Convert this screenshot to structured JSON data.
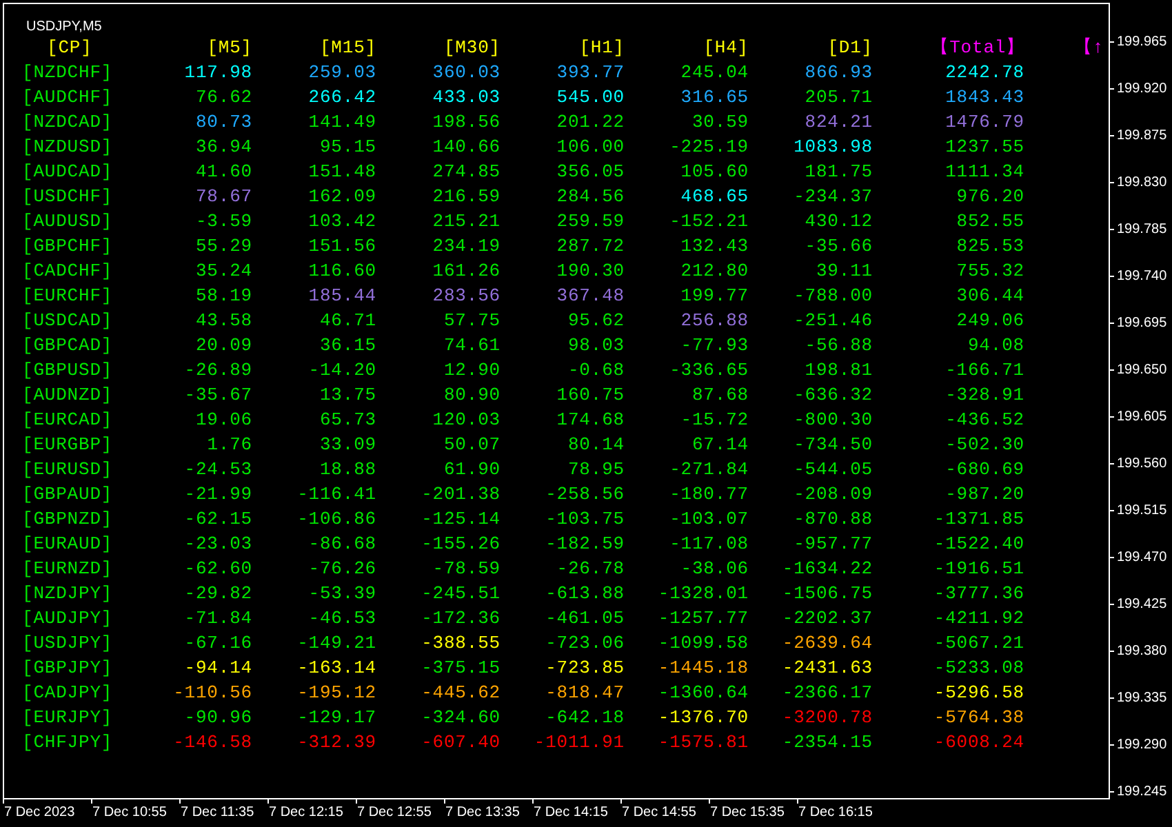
{
  "chart": {
    "title": "USDJPY,M5"
  },
  "table": {
    "pair_column": {
      "label": "[CP]",
      "color": "#ffff00"
    },
    "columns": [
      {
        "label": "[M5]",
        "color": "#ffff00"
      },
      {
        "label": "[M15]",
        "color": "#ffff00"
      },
      {
        "label": "[M30]",
        "color": "#ffff00"
      },
      {
        "label": "[H1]",
        "color": "#ffff00"
      },
      {
        "label": "[H4]",
        "color": "#ffff00"
      },
      {
        "label": "[D1]",
        "color": "#ffff00"
      },
      {
        "label": "【Total】",
        "color": "#ff00ff"
      },
      {
        "label": "【↑",
        "color": "#ff00ff"
      }
    ],
    "rows": [
      {
        "pair": "[NZDCHF]",
        "cells": [
          {
            "text": "117.98",
            "color": "#00ffff"
          },
          {
            "text": "259.03",
            "color": "#1eaaff"
          },
          {
            "text": "360.03",
            "color": "#1eaaff"
          },
          {
            "text": "393.77",
            "color": "#1eaaff"
          },
          {
            "text": "245.04",
            "color": "#00e600"
          },
          {
            "text": "866.93",
            "color": "#1eaaff"
          },
          {
            "text": "2242.78",
            "color": "#00ffff"
          }
        ]
      },
      {
        "pair": "[AUDCHF]",
        "cells": [
          {
            "text": "76.62",
            "color": "#00e600"
          },
          {
            "text": "266.42",
            "color": "#00ffff"
          },
          {
            "text": "433.03",
            "color": "#00ffff"
          },
          {
            "text": "545.00",
            "color": "#00ffff"
          },
          {
            "text": "316.65",
            "color": "#1eaaff"
          },
          {
            "text": "205.71",
            "color": "#00e600"
          },
          {
            "text": "1843.43",
            "color": "#1eaaff"
          }
        ]
      },
      {
        "pair": "[NZDCAD]",
        "cells": [
          {
            "text": "80.73",
            "color": "#1eaaff"
          },
          {
            "text": "141.49",
            "color": "#00e600"
          },
          {
            "text": "198.56",
            "color": "#00e600"
          },
          {
            "text": "201.22",
            "color": "#00e600"
          },
          {
            "text": "30.59",
            "color": "#00e600"
          },
          {
            "text": "824.21",
            "color": "#9370db"
          },
          {
            "text": "1476.79",
            "color": "#9370db"
          }
        ]
      },
      {
        "pair": "[NZDUSD]",
        "cells": [
          {
            "text": "36.94",
            "color": "#00e600"
          },
          {
            "text": "95.15",
            "color": "#00e600"
          },
          {
            "text": "140.66",
            "color": "#00e600"
          },
          {
            "text": "106.00",
            "color": "#00e600"
          },
          {
            "text": "-225.19",
            "color": "#00e600"
          },
          {
            "text": "1083.98",
            "color": "#00ffff"
          },
          {
            "text": "1237.55",
            "color": "#00e600"
          }
        ]
      },
      {
        "pair": "[AUDCAD]",
        "cells": [
          {
            "text": "41.60",
            "color": "#00e600"
          },
          {
            "text": "151.48",
            "color": "#00e600"
          },
          {
            "text": "274.85",
            "color": "#00e600"
          },
          {
            "text": "356.05",
            "color": "#00e600"
          },
          {
            "text": "105.60",
            "color": "#00e600"
          },
          {
            "text": "181.75",
            "color": "#00e600"
          },
          {
            "text": "1111.34",
            "color": "#00e600"
          }
        ]
      },
      {
        "pair": "[USDCHF]",
        "cells": [
          {
            "text": "78.67",
            "color": "#9370db"
          },
          {
            "text": "162.09",
            "color": "#00e600"
          },
          {
            "text": "216.59",
            "color": "#00e600"
          },
          {
            "text": "284.56",
            "color": "#00e600"
          },
          {
            "text": "468.65",
            "color": "#00ffff"
          },
          {
            "text": "-234.37",
            "color": "#00e600"
          },
          {
            "text": "976.20",
            "color": "#00e600"
          }
        ]
      },
      {
        "pair": "[AUDUSD]",
        "cells": [
          {
            "text": "-3.59",
            "color": "#00e600"
          },
          {
            "text": "103.42",
            "color": "#00e600"
          },
          {
            "text": "215.21",
            "color": "#00e600"
          },
          {
            "text": "259.59",
            "color": "#00e600"
          },
          {
            "text": "-152.21",
            "color": "#00e600"
          },
          {
            "text": "430.12",
            "color": "#00e600"
          },
          {
            "text": "852.55",
            "color": "#00e600"
          }
        ]
      },
      {
        "pair": "[GBPCHF]",
        "cells": [
          {
            "text": "55.29",
            "color": "#00e600"
          },
          {
            "text": "151.56",
            "color": "#00e600"
          },
          {
            "text": "234.19",
            "color": "#00e600"
          },
          {
            "text": "287.72",
            "color": "#00e600"
          },
          {
            "text": "132.43",
            "color": "#00e600"
          },
          {
            "text": "-35.66",
            "color": "#00e600"
          },
          {
            "text": "825.53",
            "color": "#00e600"
          }
        ]
      },
      {
        "pair": "[CADCHF]",
        "cells": [
          {
            "text": "35.24",
            "color": "#00e600"
          },
          {
            "text": "116.60",
            "color": "#00e600"
          },
          {
            "text": "161.26",
            "color": "#00e600"
          },
          {
            "text": "190.30",
            "color": "#00e600"
          },
          {
            "text": "212.80",
            "color": "#00e600"
          },
          {
            "text": "39.11",
            "color": "#00e600"
          },
          {
            "text": "755.32",
            "color": "#00e600"
          }
        ]
      },
      {
        "pair": "[EURCHF]",
        "cells": [
          {
            "text": "58.19",
            "color": "#00e600"
          },
          {
            "text": "185.44",
            "color": "#9370db"
          },
          {
            "text": "283.56",
            "color": "#9370db"
          },
          {
            "text": "367.48",
            "color": "#9370db"
          },
          {
            "text": "199.77",
            "color": "#00e600"
          },
          {
            "text": "-788.00",
            "color": "#00e600"
          },
          {
            "text": "306.44",
            "color": "#00e600"
          }
        ]
      },
      {
        "pair": "[USDCAD]",
        "cells": [
          {
            "text": "43.58",
            "color": "#00e600"
          },
          {
            "text": "46.71",
            "color": "#00e600"
          },
          {
            "text": "57.75",
            "color": "#00e600"
          },
          {
            "text": "95.62",
            "color": "#00e600"
          },
          {
            "text": "256.88",
            "color": "#9370db"
          },
          {
            "text": "-251.46",
            "color": "#00e600"
          },
          {
            "text": "249.06",
            "color": "#00e600"
          }
        ]
      },
      {
        "pair": "[GBPCAD]",
        "cells": [
          {
            "text": "20.09",
            "color": "#00e600"
          },
          {
            "text": "36.15",
            "color": "#00e600"
          },
          {
            "text": "74.61",
            "color": "#00e600"
          },
          {
            "text": "98.03",
            "color": "#00e600"
          },
          {
            "text": "-77.93",
            "color": "#00e600"
          },
          {
            "text": "-56.88",
            "color": "#00e600"
          },
          {
            "text": "94.08",
            "color": "#00e600"
          }
        ]
      },
      {
        "pair": "[GBPUSD]",
        "cells": [
          {
            "text": "-26.89",
            "color": "#00e600"
          },
          {
            "text": "-14.20",
            "color": "#00e600"
          },
          {
            "text": "12.90",
            "color": "#00e600"
          },
          {
            "text": "-0.68",
            "color": "#00e600"
          },
          {
            "text": "-336.65",
            "color": "#00e600"
          },
          {
            "text": "198.81",
            "color": "#00e600"
          },
          {
            "text": "-166.71",
            "color": "#00e600"
          }
        ]
      },
      {
        "pair": "[AUDNZD]",
        "cells": [
          {
            "text": "-35.67",
            "color": "#00e600"
          },
          {
            "text": "13.75",
            "color": "#00e600"
          },
          {
            "text": "80.90",
            "color": "#00e600"
          },
          {
            "text": "160.75",
            "color": "#00e600"
          },
          {
            "text": "87.68",
            "color": "#00e600"
          },
          {
            "text": "-636.32",
            "color": "#00e600"
          },
          {
            "text": "-328.91",
            "color": "#00e600"
          }
        ]
      },
      {
        "pair": "[EURCAD]",
        "cells": [
          {
            "text": "19.06",
            "color": "#00e600"
          },
          {
            "text": "65.73",
            "color": "#00e600"
          },
          {
            "text": "120.03",
            "color": "#00e600"
          },
          {
            "text": "174.68",
            "color": "#00e600"
          },
          {
            "text": "-15.72",
            "color": "#00e600"
          },
          {
            "text": "-800.30",
            "color": "#00e600"
          },
          {
            "text": "-436.52",
            "color": "#00e600"
          }
        ]
      },
      {
        "pair": "[EURGBP]",
        "cells": [
          {
            "text": "1.76",
            "color": "#00e600"
          },
          {
            "text": "33.09",
            "color": "#00e600"
          },
          {
            "text": "50.07",
            "color": "#00e600"
          },
          {
            "text": "80.14",
            "color": "#00e600"
          },
          {
            "text": "67.14",
            "color": "#00e600"
          },
          {
            "text": "-734.50",
            "color": "#00e600"
          },
          {
            "text": "-502.30",
            "color": "#00e600"
          }
        ]
      },
      {
        "pair": "[EURUSD]",
        "cells": [
          {
            "text": "-24.53",
            "color": "#00e600"
          },
          {
            "text": "18.88",
            "color": "#00e600"
          },
          {
            "text": "61.90",
            "color": "#00e600"
          },
          {
            "text": "78.95",
            "color": "#00e600"
          },
          {
            "text": "-271.84",
            "color": "#00e600"
          },
          {
            "text": "-544.05",
            "color": "#00e600"
          },
          {
            "text": "-680.69",
            "color": "#00e600"
          }
        ]
      },
      {
        "pair": "[GBPAUD]",
        "cells": [
          {
            "text": "-21.99",
            "color": "#00e600"
          },
          {
            "text": "-116.41",
            "color": "#00e600"
          },
          {
            "text": "-201.38",
            "color": "#00e600"
          },
          {
            "text": "-258.56",
            "color": "#00e600"
          },
          {
            "text": "-180.77",
            "color": "#00e600"
          },
          {
            "text": "-208.09",
            "color": "#00e600"
          },
          {
            "text": "-987.20",
            "color": "#00e600"
          }
        ]
      },
      {
        "pair": "[GBPNZD]",
        "cells": [
          {
            "text": "-62.15",
            "color": "#00e600"
          },
          {
            "text": "-106.86",
            "color": "#00e600"
          },
          {
            "text": "-125.14",
            "color": "#00e600"
          },
          {
            "text": "-103.75",
            "color": "#00e600"
          },
          {
            "text": "-103.07",
            "color": "#00e600"
          },
          {
            "text": "-870.88",
            "color": "#00e600"
          },
          {
            "text": "-1371.85",
            "color": "#00e600"
          }
        ]
      },
      {
        "pair": "[EURAUD]",
        "cells": [
          {
            "text": "-23.03",
            "color": "#00e600"
          },
          {
            "text": "-86.68",
            "color": "#00e600"
          },
          {
            "text": "-155.26",
            "color": "#00e600"
          },
          {
            "text": "-182.59",
            "color": "#00e600"
          },
          {
            "text": "-117.08",
            "color": "#00e600"
          },
          {
            "text": "-957.77",
            "color": "#00e600"
          },
          {
            "text": "-1522.40",
            "color": "#00e600"
          }
        ]
      },
      {
        "pair": "[EURNZD]",
        "cells": [
          {
            "text": "-62.60",
            "color": "#00e600"
          },
          {
            "text": "-76.26",
            "color": "#00e600"
          },
          {
            "text": "-78.59",
            "color": "#00e600"
          },
          {
            "text": "-26.78",
            "color": "#00e600"
          },
          {
            "text": "-38.06",
            "color": "#00e600"
          },
          {
            "text": "-1634.22",
            "color": "#00e600"
          },
          {
            "text": "-1916.51",
            "color": "#00e600"
          }
        ]
      },
      {
        "pair": "[NZDJPY]",
        "cells": [
          {
            "text": "-29.82",
            "color": "#00e600"
          },
          {
            "text": "-53.39",
            "color": "#00e600"
          },
          {
            "text": "-245.51",
            "color": "#00e600"
          },
          {
            "text": "-613.88",
            "color": "#00e600"
          },
          {
            "text": "-1328.01",
            "color": "#00e600"
          },
          {
            "text": "-1506.75",
            "color": "#00e600"
          },
          {
            "text": "-3777.36",
            "color": "#00e600"
          }
        ]
      },
      {
        "pair": "[AUDJPY]",
        "cells": [
          {
            "text": "-71.84",
            "color": "#00e600"
          },
          {
            "text": "-46.53",
            "color": "#00e600"
          },
          {
            "text": "-172.36",
            "color": "#00e600"
          },
          {
            "text": "-461.05",
            "color": "#00e600"
          },
          {
            "text": "-1257.77",
            "color": "#00e600"
          },
          {
            "text": "-2202.37",
            "color": "#00e600"
          },
          {
            "text": "-4211.92",
            "color": "#00e600"
          }
        ]
      },
      {
        "pair": "[USDJPY]",
        "cells": [
          {
            "text": "-67.16",
            "color": "#00e600"
          },
          {
            "text": "-149.21",
            "color": "#00e600"
          },
          {
            "text": "-388.55",
            "color": "#ffff00"
          },
          {
            "text": "-723.06",
            "color": "#00e600"
          },
          {
            "text": "-1099.58",
            "color": "#00e600"
          },
          {
            "text": "-2639.64",
            "color": "#ffa500"
          },
          {
            "text": "-5067.21",
            "color": "#00e600"
          }
        ]
      },
      {
        "pair": "[GBPJPY]",
        "cells": [
          {
            "text": "-94.14",
            "color": "#ffff00"
          },
          {
            "text": "-163.14",
            "color": "#ffff00"
          },
          {
            "text": "-375.15",
            "color": "#00e600"
          },
          {
            "text": "-723.85",
            "color": "#ffff00"
          },
          {
            "text": "-1445.18",
            "color": "#ffa500"
          },
          {
            "text": "-2431.63",
            "color": "#ffff00"
          },
          {
            "text": "-5233.08",
            "color": "#00e600"
          }
        ]
      },
      {
        "pair": "[CADJPY]",
        "cells": [
          {
            "text": "-110.56",
            "color": "#ffa500"
          },
          {
            "text": "-195.12",
            "color": "#ffa500"
          },
          {
            "text": "-445.62",
            "color": "#ffa500"
          },
          {
            "text": "-818.47",
            "color": "#ffa500"
          },
          {
            "text": "-1360.64",
            "color": "#00e600"
          },
          {
            "text": "-2366.17",
            "color": "#00e600"
          },
          {
            "text": "-5296.58",
            "color": "#ffff00"
          }
        ]
      },
      {
        "pair": "[EURJPY]",
        "cells": [
          {
            "text": "-90.96",
            "color": "#00e600"
          },
          {
            "text": "-129.17",
            "color": "#00e600"
          },
          {
            "text": "-324.60",
            "color": "#00e600"
          },
          {
            "text": "-642.18",
            "color": "#00e600"
          },
          {
            "text": "-1376.70",
            "color": "#ffff00"
          },
          {
            "text": "-3200.78",
            "color": "#ff0000"
          },
          {
            "text": "-5764.38",
            "color": "#ffa500"
          }
        ]
      },
      {
        "pair": "[CHFJPY]",
        "cells": [
          {
            "text": "-146.58",
            "color": "#ff0000"
          },
          {
            "text": "-312.39",
            "color": "#ff0000"
          },
          {
            "text": "-607.40",
            "color": "#ff0000"
          },
          {
            "text": "-1011.91",
            "color": "#ff0000"
          },
          {
            "text": "-1575.81",
            "color": "#ff0000"
          },
          {
            "text": "-2354.15",
            "color": "#00e600"
          },
          {
            "text": "-6008.24",
            "color": "#ff0000"
          }
        ]
      }
    ]
  },
  "price_axis": [
    "199.965",
    "199.920",
    "199.875",
    "199.830",
    "199.785",
    "199.740",
    "199.695",
    "199.650",
    "199.605",
    "199.560",
    "199.515",
    "199.470",
    "199.425",
    "199.380",
    "199.335",
    "199.290",
    "199.245"
  ],
  "time_axis": [
    "7 Dec 2023",
    "7 Dec 10:55",
    "7 Dec 11:35",
    "7 Dec 12:15",
    "7 Dec 12:55",
    "7 Dec 13:35",
    "7 Dec 14:15",
    "7 Dec 14:55",
    "7 Dec 15:35",
    "7 Dec 16:15"
  ]
}
